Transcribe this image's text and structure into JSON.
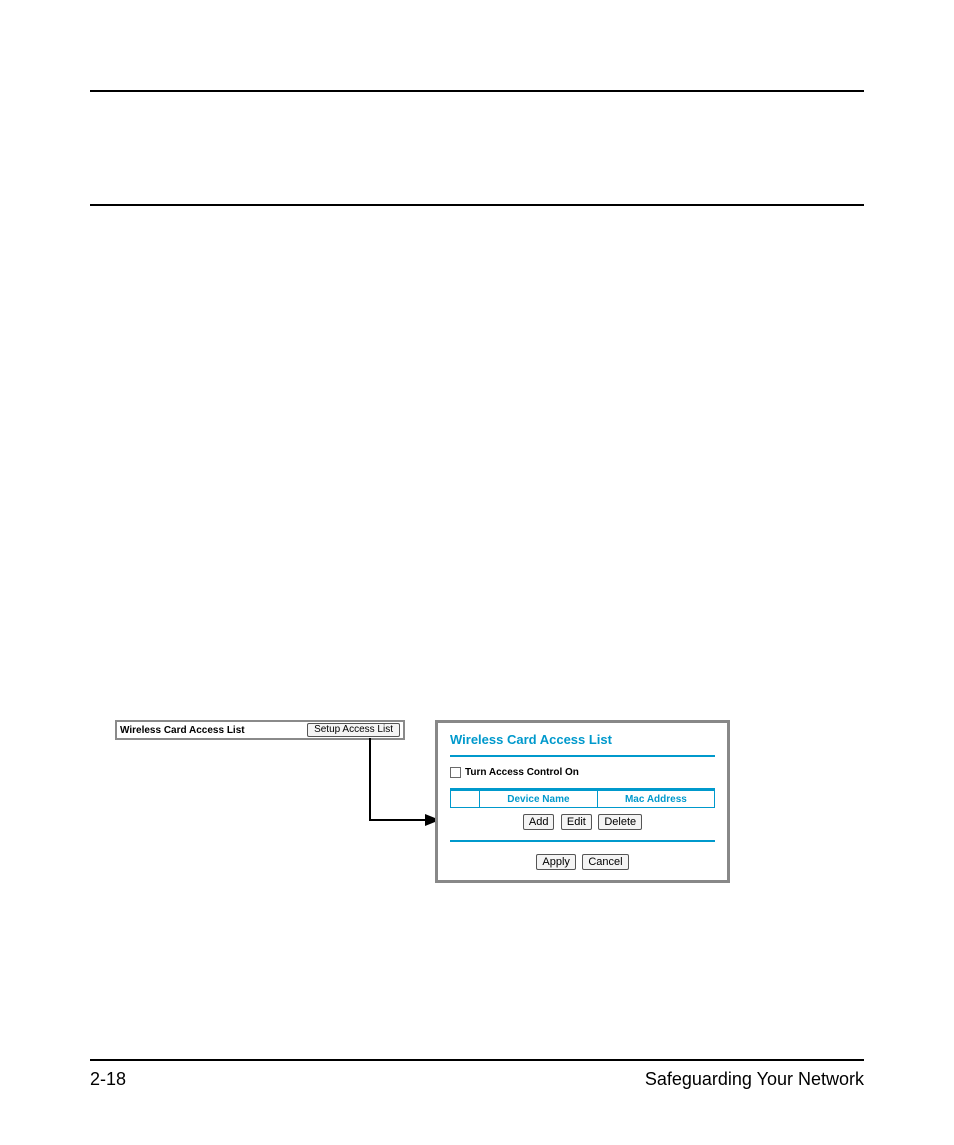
{
  "footer": {
    "page_number": "2-18",
    "section_title": "Safeguarding Your Network"
  },
  "figure": {
    "small_panel": {
      "label": "Wireless Card Access List",
      "button": "Setup Access List"
    },
    "large_panel": {
      "title": "Wireless Card Access List",
      "checkbox_label": "Turn Access Control On",
      "col_device": "Device Name",
      "col_mac": "Mac Address",
      "btn_add": "Add",
      "btn_edit": "Edit",
      "btn_delete": "Delete",
      "btn_apply": "Apply",
      "btn_cancel": "Cancel"
    }
  }
}
